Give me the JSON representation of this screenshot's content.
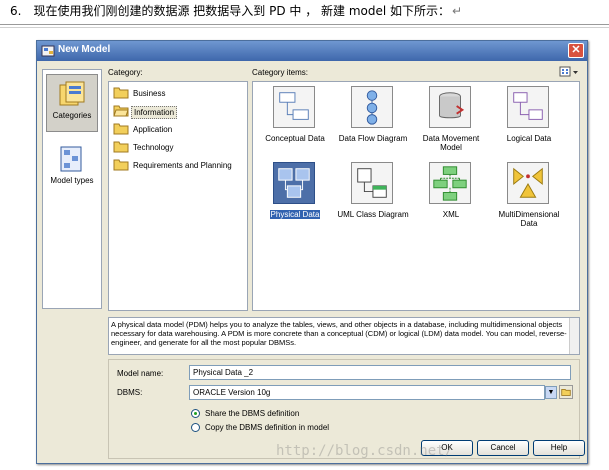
{
  "doc": {
    "item_number": "6.",
    "text": "现在使用我们刚创建的数据源 把数据导入到 PD 中 ， 新建 model  如下所示：",
    "return_mark": "↵"
  },
  "window": {
    "title": "New Model",
    "close_glyph": "✕"
  },
  "left_bar": {
    "items": [
      {
        "label": "Categories",
        "icon": "categories-icon",
        "selected": true
      },
      {
        "label": "Model types",
        "icon": "model-types-icon",
        "selected": false
      }
    ]
  },
  "category": {
    "label": "Category:",
    "items": [
      {
        "label": "Business",
        "selected": false
      },
      {
        "label": "Information",
        "selected": true
      },
      {
        "label": "Application",
        "selected": false
      },
      {
        "label": "Technology",
        "selected": false
      },
      {
        "label": "Requirements and Planning",
        "selected": false
      }
    ]
  },
  "category_items": {
    "label": "Category items:",
    "tiles": [
      {
        "label": "Conceptual Data",
        "icon": "conceptual-data-icon",
        "selected": false
      },
      {
        "label": "Data Flow Diagram",
        "icon": "data-flow-diagram-icon",
        "selected": false
      },
      {
        "label": "Data Movement Model",
        "icon": "data-movement-model-icon",
        "selected": false
      },
      {
        "label": "Logical Data",
        "icon": "logical-data-icon",
        "selected": false
      },
      {
        "label": "Physical Data",
        "icon": "physical-data-icon",
        "selected": true
      },
      {
        "label": "UML Class Diagram",
        "icon": "uml-class-diagram-icon",
        "selected": false
      },
      {
        "label": "XML",
        "icon": "xml-icon",
        "selected": false
      },
      {
        "label": "MultiDimensional Data",
        "icon": "multidimensional-data-icon",
        "selected": false
      }
    ]
  },
  "description": "A physical data model (PDM) helps you to analyze the tables, views, and other objects in a database, including multidimensional objects necessary for data warehousing. A PDM is more concrete than a conceptual (CDM) or logical (LDM) data model. You can model, reverse-engineer, and generate for all the most popular DBMSs.",
  "form": {
    "model_name_label": "Model name:",
    "model_name_value": "Physical Data _2",
    "dbms_label": "DBMS:",
    "dbms_value": "ORACLE Version 10g",
    "radio_share": "Share the DBMS definition",
    "radio_copy": "Copy the DBMS definition in model",
    "radio_selected": "share"
  },
  "buttons": {
    "ok": "OK",
    "cancel": "Cancel",
    "help": "Help"
  },
  "watermark": "http://blog.csdn.net/",
  "colors": {
    "title_bar": "#3e67ab",
    "selection": "#3162b0",
    "window_bg": "#ece9d8"
  }
}
